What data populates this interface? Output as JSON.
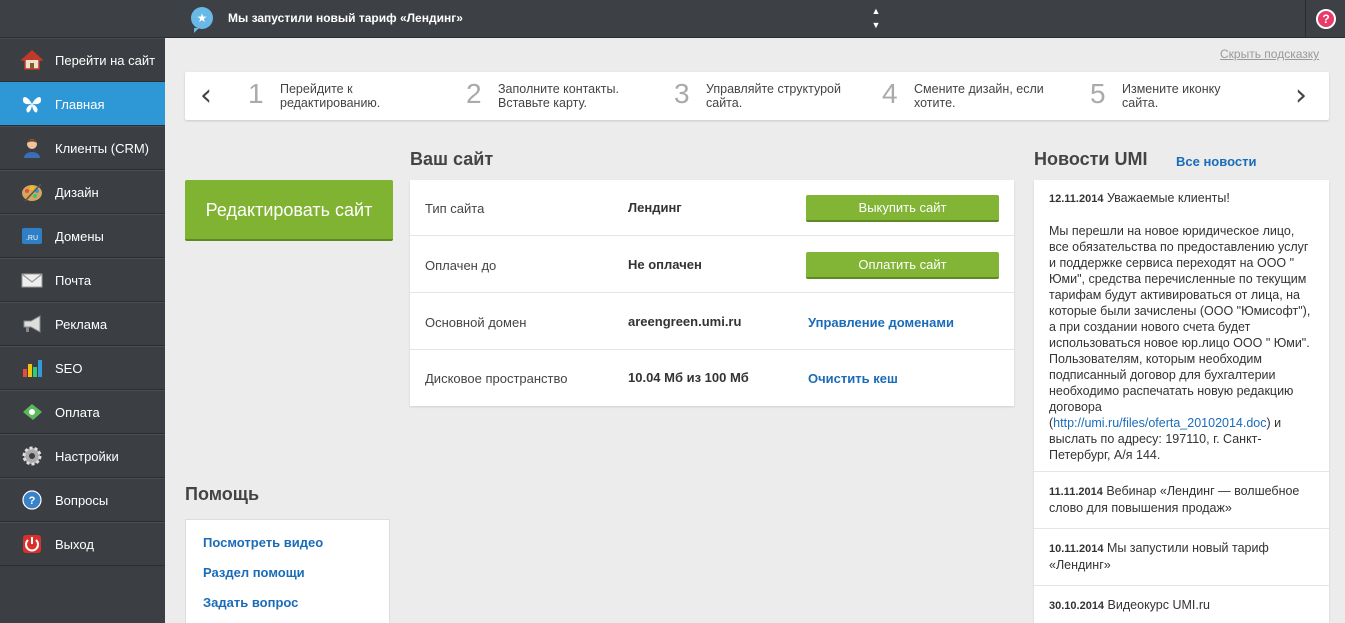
{
  "topbar": {
    "notice_icon": "star-bubble-icon",
    "notice": "Мы запустили новый тариф «Лендинг»",
    "arrow_up": "▲",
    "arrow_down": "▼",
    "help_icon": "question-icon",
    "help_glyph": "?"
  },
  "sidebar": {
    "items": [
      {
        "label": "Перейти на сайт",
        "icon": "home-icon"
      },
      {
        "label": "Главная",
        "icon": "butterfly-icon"
      },
      {
        "label": "Клиенты (CRM)",
        "icon": "user-icon"
      },
      {
        "label": "Дизайн",
        "icon": "palette-icon"
      },
      {
        "label": "Домены",
        "icon": "domain-icon"
      },
      {
        "label": "Почта",
        "icon": "mail-icon"
      },
      {
        "label": "Реклама",
        "icon": "megaphone-icon"
      },
      {
        "label": "SEO",
        "icon": "bar-chart-icon"
      },
      {
        "label": "Оплата",
        "icon": "payment-icon"
      },
      {
        "label": "Настройки",
        "icon": "gear-icon"
      },
      {
        "label": "Вопросы",
        "icon": "question-icon"
      },
      {
        "label": "Выход",
        "icon": "power-icon"
      }
    ],
    "active_index": 1,
    "domain_icon_text": ".RU"
  },
  "hint": {
    "hide_label": "Скрыть подсказку",
    "prev": "‹",
    "next": "›",
    "steps": [
      {
        "num": "1",
        "text": "Перейдите к редактированию."
      },
      {
        "num": "2",
        "text": "Заполните контакты. Вставьте карту."
      },
      {
        "num": "3",
        "text": "Управляйте структурой сайта."
      },
      {
        "num": "4",
        "text": "Смените дизайн, если хотите."
      },
      {
        "num": "5",
        "text": "Измените иконку сайта."
      }
    ]
  },
  "edit_button": "Редактировать сайт",
  "site": {
    "title": "Ваш сайт",
    "rows": [
      {
        "key": "Тип сайта",
        "value": "Лендинг",
        "action": "Выкупить сайт",
        "action_type": "button"
      },
      {
        "key": "Оплачен до",
        "value": "Не оплачен",
        "action": "Оплатить сайт",
        "action_type": "button"
      },
      {
        "key": "Основной домен",
        "value": "areengreen.umi.ru",
        "action": "Управление доменами",
        "action_type": "link"
      },
      {
        "key": "Дисковое пространство",
        "value": "10.04 Мб из 100 Мб",
        "action": "Очистить кеш",
        "action_type": "link"
      }
    ]
  },
  "help": {
    "title": "Помощь",
    "links": [
      "Посмотреть видео",
      "Раздел помощи",
      "Задать вопрос"
    ]
  },
  "news": {
    "title": "Новости UMI",
    "all_link": "Все новости",
    "items": [
      {
        "date": "12.11.2014",
        "headline": "Уважаемые клиенты!",
        "body_before": "Мы перешли на новое юридическое лицо, все обязательства по предоставлению услуг и поддержке сервиса переходят на ООО \" Юми\", средства перечисленные по текущим тарифам будут активироваться от лица, на которые были зачислены (ООО \"Юмисофт\"), а при создании нового счета будет использоваться новое юр.лицо ООО \" Юми\". Пользователям, которым необходим подписанный договор для бухгалтерии необходимо распечатать новую редакцию договора (",
        "link": "http://umi.ru/files/oferta_20102014.doc",
        "body_after": ") и выслать по адресу: 197110, г. Санкт-Петербург, А/я 144."
      },
      {
        "date": "11.11.2014",
        "headline": "Вебинар «Лендинг — волшебное слово для повышения продаж»"
      },
      {
        "date": "10.11.2014",
        "headline": "Мы запустили новый тариф «Лендинг»"
      },
      {
        "date": "30.10.2014",
        "headline": "Видеокурс UMI.ru"
      }
    ]
  },
  "colors": {
    "accent_blue": "#2e97d6",
    "green_button": "#7fb331",
    "link_blue": "#1a6cb8",
    "help_pink": "#e93a6a"
  }
}
